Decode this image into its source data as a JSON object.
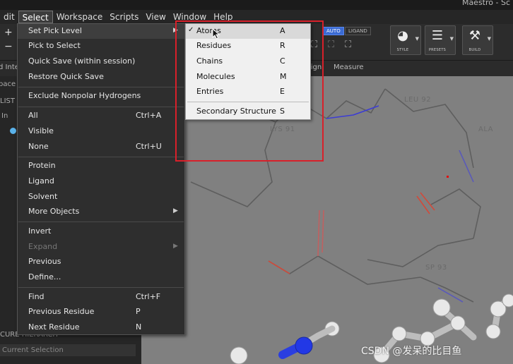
{
  "app": {
    "title": "Maestro - Sc"
  },
  "menubar": {
    "items": [
      "dit",
      "Select",
      "Workspace",
      "Scripts",
      "View",
      "Window",
      "Help"
    ],
    "active": "Select"
  },
  "toolbar": {
    "toggles": {
      "auto": "AUTO",
      "ligand": "LIGAND"
    },
    "buttons": [
      {
        "caption": "STYLE",
        "icon": "style-icon"
      },
      {
        "caption": "PRESETS",
        "icon": "sliders-icon"
      },
      {
        "caption": "BUILD",
        "icon": "build-icon"
      }
    ]
  },
  "tabstrip": {
    "left": "d Inte",
    "align": "lign",
    "measure": "Measure"
  },
  "left_panel": {
    "space": "pace",
    "list": "LIST",
    "in": "In",
    "struct": "CURE HIERARCH",
    "selection": "Current Selection"
  },
  "workspace": {
    "residues": [
      "LEU 92",
      "LYS 91",
      "ALA",
      "SP 93"
    ]
  },
  "select_menu": {
    "items": [
      {
        "label": "Set Pick Level",
        "submenu": true,
        "highlighted": true
      },
      {
        "label": "Pick to Select"
      },
      {
        "label": "Quick Save (within session)"
      },
      {
        "label": "Restore Quick Save"
      },
      {
        "label": "Exclude Nonpolar Hydrogens"
      },
      {
        "label": "All",
        "shortcut": "Ctrl+A"
      },
      {
        "label": "Visible"
      },
      {
        "label": "None",
        "shortcut": "Ctrl+U"
      },
      {
        "label": "Protein"
      },
      {
        "label": "Ligand"
      },
      {
        "label": "Solvent"
      },
      {
        "label": "More Objects",
        "submenu": true
      },
      {
        "label": "Invert"
      },
      {
        "label": "Expand",
        "submenu": true,
        "disabled": true
      },
      {
        "label": "Previous"
      },
      {
        "label": "Define..."
      },
      {
        "label": "Find",
        "shortcut": "Ctrl+F"
      },
      {
        "label": "Previous Residue",
        "shortcut": "P"
      },
      {
        "label": "Next Residue",
        "shortcut": "N"
      }
    ]
  },
  "pick_level_submenu": {
    "items": [
      {
        "label": "Atoms",
        "shortcut": "A",
        "checked": true
      },
      {
        "label": "Residues",
        "shortcut": "R"
      },
      {
        "label": "Chains",
        "shortcut": "C"
      },
      {
        "label": "Molecules",
        "shortcut": "M"
      },
      {
        "label": "Entries",
        "shortcut": "E"
      },
      {
        "label": "Secondary Structure",
        "shortcut": "S"
      }
    ],
    "checkmark": "✓"
  },
  "watermark": "CSDN @发呆的比目鱼",
  "colors": {
    "highlight_box": "#d8202a",
    "workspace_bg": "#808080",
    "menu_bg": "#2e2e2e",
    "submenu_bg": "#f0f0f0",
    "active_toggle": "#3b6bd4"
  }
}
